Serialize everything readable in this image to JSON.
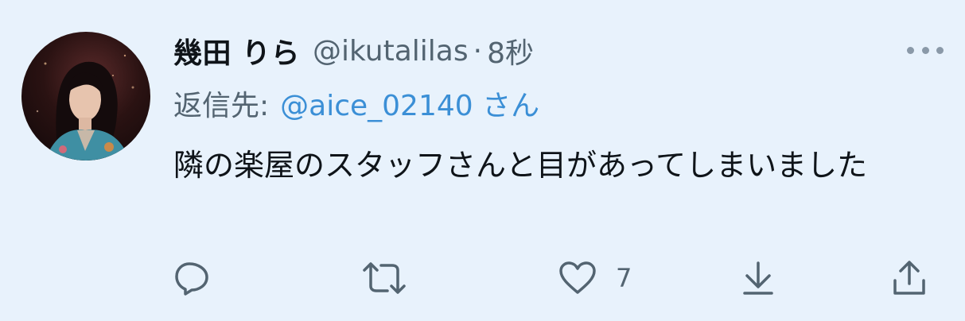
{
  "tweet": {
    "display_name": "幾田 りら",
    "handle": "@ikutalilas",
    "separator": "·",
    "time": "8秒",
    "reply_prefix": "返信先:",
    "reply_mention": "@aice_02140 さん",
    "text": "隣の楽屋のスタッフさんと目があってしまいました",
    "like_count": "7"
  },
  "icons": {
    "more": "more-horizontal-icon",
    "reply": "reply-icon",
    "retweet": "retweet-icon",
    "like": "heart-icon",
    "download": "download-icon",
    "share": "share-icon"
  },
  "colors": {
    "background": "#e8f2fc",
    "text_primary": "#0f1419",
    "text_secondary": "#536471",
    "mention": "#3b8fd6"
  }
}
